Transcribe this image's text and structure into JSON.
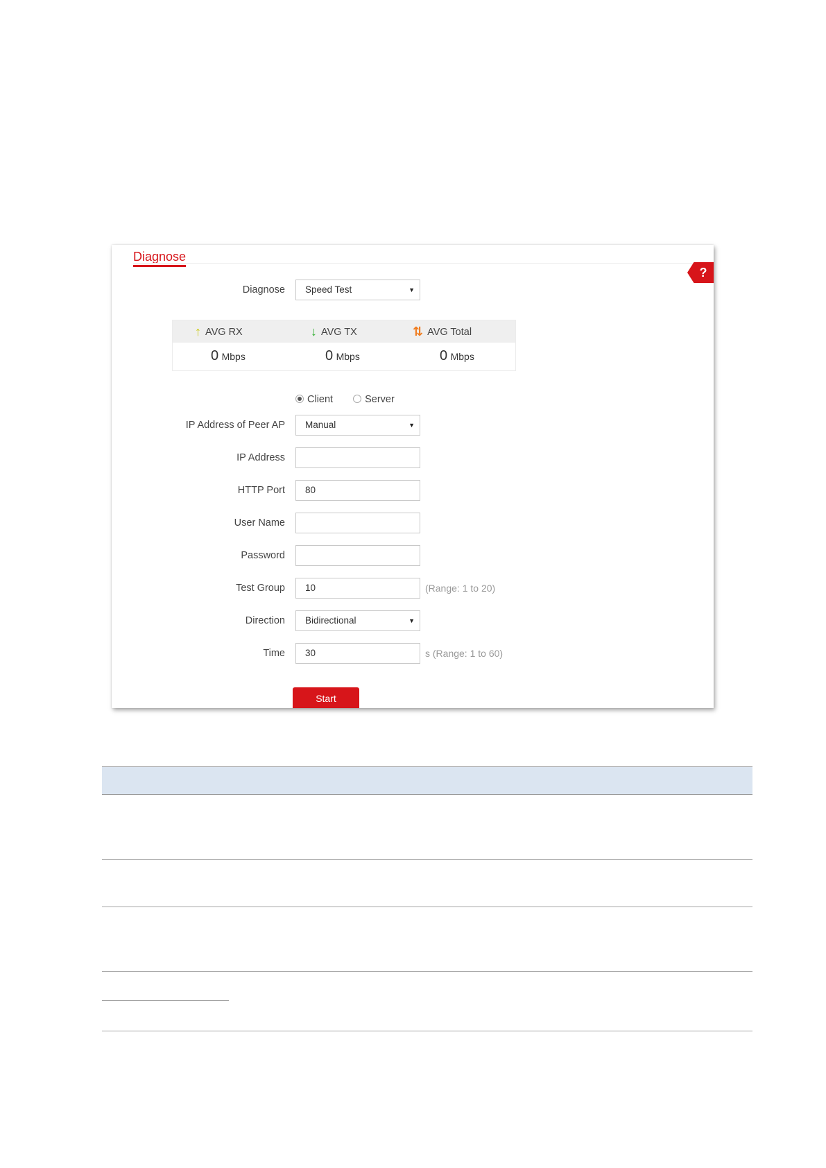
{
  "panel": {
    "title": "Diagnose",
    "help_label": "?"
  },
  "form": {
    "diagnose": {
      "label": "Diagnose",
      "value": "Speed Test"
    },
    "stats": {
      "rx": {
        "label": "AVG RX",
        "value": "0",
        "unit": "Mbps"
      },
      "tx": {
        "label": "AVG TX",
        "value": "0",
        "unit": "Mbps"
      },
      "total": {
        "label": "AVG Total",
        "value": "0",
        "unit": "Mbps"
      }
    },
    "mode": {
      "options": [
        "Client",
        "Server"
      ],
      "selected": "Client"
    },
    "peer_ip_mode": {
      "label": "IP Address of Peer AP",
      "value": "Manual"
    },
    "ip_address": {
      "label": "IP Address",
      "value": ""
    },
    "http_port": {
      "label": "HTTP Port",
      "value": "80"
    },
    "user_name": {
      "label": "User Name",
      "value": ""
    },
    "password": {
      "label": "Password",
      "value": ""
    },
    "test_group": {
      "label": "Test Group",
      "value": "10",
      "hint": "(Range: 1 to 20)"
    },
    "direction": {
      "label": "Direction",
      "value": "Bidirectional"
    },
    "time": {
      "label": "Time",
      "value": "30",
      "hint": "s (Range: 1 to 60)"
    },
    "start_label": "Start"
  },
  "colors": {
    "accent": "#d7151a",
    "rx_arrow": "#c8c800",
    "tx_arrow": "#2eae2e",
    "total_arrow": "#f07c1f",
    "table_header": "#dbe5f1"
  }
}
